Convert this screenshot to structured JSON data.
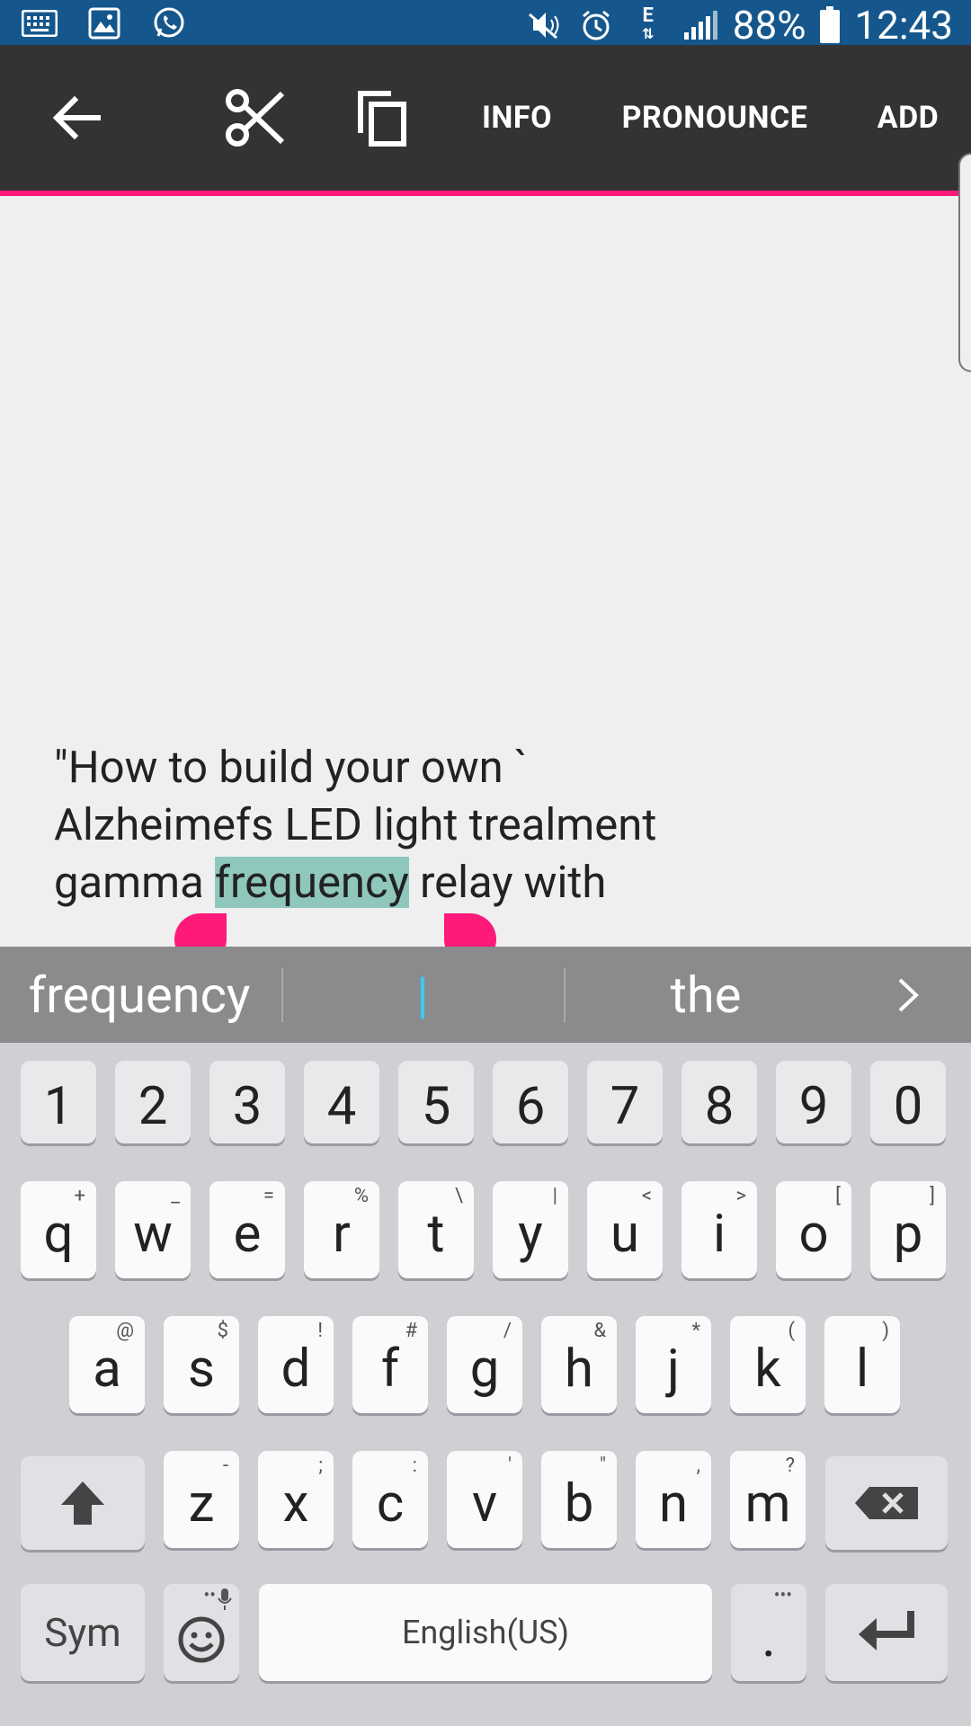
{
  "status_bar": {
    "battery": "88%",
    "time": "12:43",
    "network": "E"
  },
  "action_bar": {
    "info_label": "INFO",
    "pronounce_label": "PRONOUNCE",
    "add_label": "ADD"
  },
  "editor": {
    "text_before": "\"How to build your own `\nAlzheimefs LED light trealment\ngamma ",
    "selected": "frequency",
    "text_after": " relay with"
  },
  "suggestions": {
    "left": "frequency",
    "middle": "|",
    "right": "the"
  },
  "keyboard": {
    "number_row": [
      "1",
      "2",
      "3",
      "4",
      "5",
      "6",
      "7",
      "8",
      "9",
      "0"
    ],
    "row1": [
      {
        "key": "q",
        "alt": "+"
      },
      {
        "key": "w",
        "alt": "_"
      },
      {
        "key": "e",
        "alt": "="
      },
      {
        "key": "r",
        "alt": "%"
      },
      {
        "key": "t",
        "alt": "\\"
      },
      {
        "key": "y",
        "alt": "|"
      },
      {
        "key": "u",
        "alt": "<"
      },
      {
        "key": "i",
        "alt": ">"
      },
      {
        "key": "o",
        "alt": "["
      },
      {
        "key": "p",
        "alt": "]"
      }
    ],
    "row2": [
      {
        "key": "a",
        "alt": "@"
      },
      {
        "key": "s",
        "alt": "$"
      },
      {
        "key": "d",
        "alt": "!"
      },
      {
        "key": "f",
        "alt": "#"
      },
      {
        "key": "g",
        "alt": "/"
      },
      {
        "key": "h",
        "alt": "&"
      },
      {
        "key": "j",
        "alt": "*"
      },
      {
        "key": "k",
        "alt": "("
      },
      {
        "key": "l",
        "alt": ")"
      }
    ],
    "row3": [
      {
        "key": "z",
        "alt": "-"
      },
      {
        "key": "x",
        "alt": ";"
      },
      {
        "key": "c",
        "alt": ":"
      },
      {
        "key": "v",
        "alt": "'"
      },
      {
        "key": "b",
        "alt": "\""
      },
      {
        "key": "n",
        "alt": ","
      },
      {
        "key": "m",
        "alt": "?"
      }
    ],
    "sym_label": "Sym",
    "space_label": "English(US)",
    "period_label": ".",
    "period_alt": "•••",
    "emoji_alt": "••"
  },
  "colors": {
    "accent": "#ff1a7a",
    "status_bar": "#15578c",
    "action_bar": "#333333",
    "selection": "#8fc7bd"
  }
}
